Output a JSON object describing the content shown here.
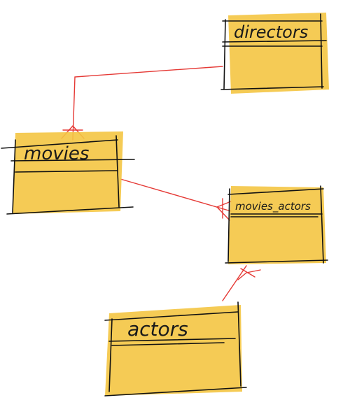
{
  "diagram": {
    "entities": [
      {
        "id": "directors",
        "label": "directors"
      },
      {
        "id": "movies",
        "label": "movies"
      },
      {
        "id": "movies_actors",
        "label": "movies_actors"
      },
      {
        "id": "actors",
        "label": "actors"
      }
    ],
    "relations": [
      {
        "from": "directors",
        "to": "movies",
        "end_marker": "crow-foot"
      },
      {
        "from": "movies",
        "to": "movies_actors",
        "end_marker": "crow-foot"
      },
      {
        "from": "actors",
        "to": "movies_actors",
        "end_marker": "crow-foot"
      }
    ],
    "colors": {
      "fill": "#f4c542",
      "outline": "#111111",
      "relation": "#e53935"
    }
  }
}
